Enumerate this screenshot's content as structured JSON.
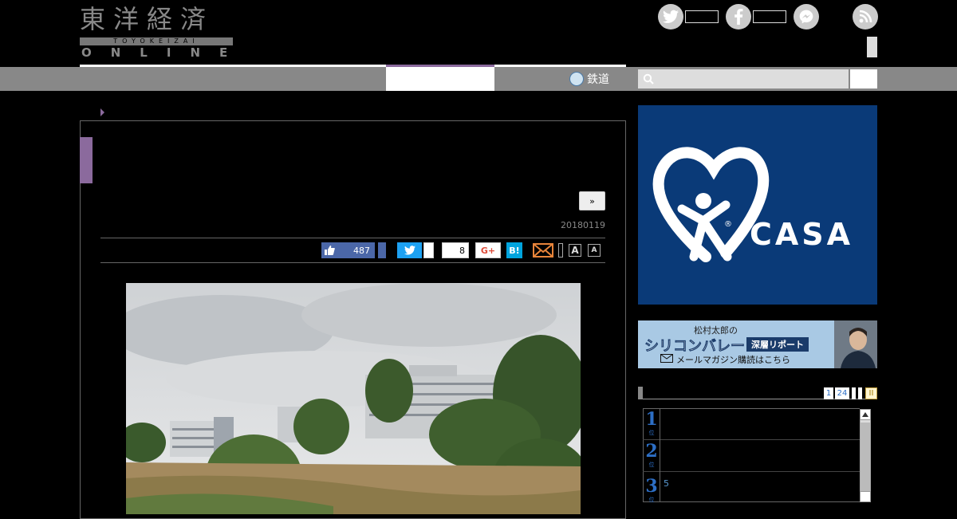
{
  "header": {
    "logo_kanji": "東洋経済",
    "logo_sub": "TOYOKEIZAI",
    "logo_online": "ONLINE",
    "social": [
      {
        "name": "twitter-icon",
        "glyph": "t"
      },
      {
        "name": "facebook-icon",
        "glyph": "f"
      },
      {
        "name": "messenger-icon",
        "glyph": "~"
      }
    ]
  },
  "nav": {
    "rail_label": "鉄道",
    "search_placeholder": ""
  },
  "article": {
    "more_label": "»",
    "date": "20180119",
    "share": {
      "facebook_count": "487",
      "hatena_count": "8",
      "gplus_label": "G+",
      "hatena_label": "B!",
      "font_large": "A",
      "font_small": "A"
    }
  },
  "sidebar": {
    "casa_text": "CASA",
    "casa_reg": "®",
    "newsletter": {
      "author": "松村太郎の",
      "title": "シリコンバレー",
      "box": "深層リポート",
      "cta": "メールマガジン購読はこちら"
    },
    "ranking": {
      "tabs": [
        "1",
        "24",
        "",
        "",
        "II"
      ],
      "items": [
        {
          "num": "1",
          "sub": "位",
          "text": ""
        },
        {
          "num": "2",
          "sub": "位",
          "text": ""
        },
        {
          "num": "3",
          "sub": "位",
          "text": "5"
        }
      ]
    }
  },
  "colors": {
    "accent": "#8b6a9d",
    "nav_gray": "#888888",
    "casa_blue": "#0a3a78",
    "rank_blue": "#2d6fc6"
  }
}
